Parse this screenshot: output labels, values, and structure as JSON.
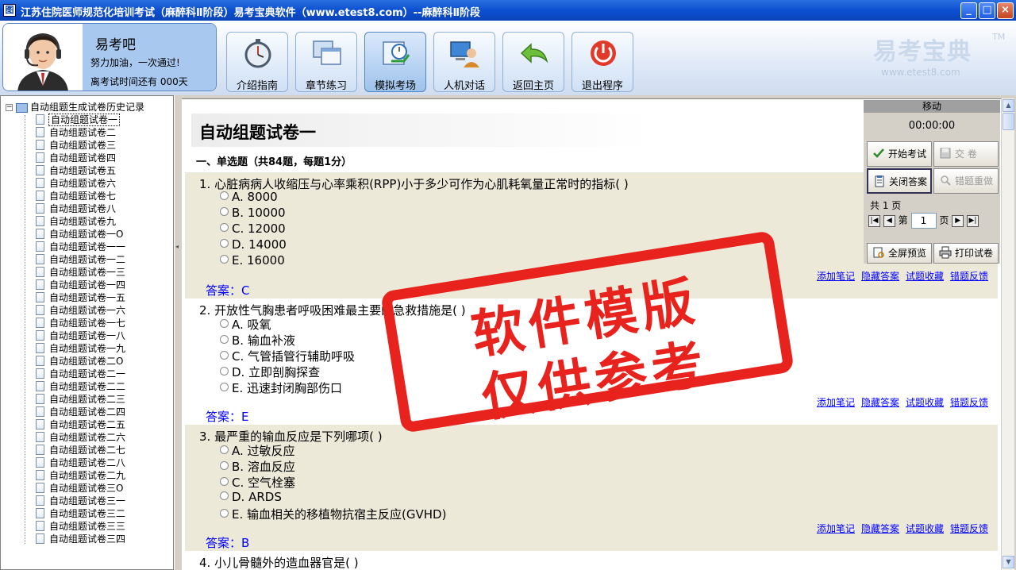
{
  "window": {
    "title": "江苏住院医师规范化培训考试（麻醉科Ⅱ阶段）易考宝典软件（www.etest8.com）--麻醉科Ⅱ阶段",
    "icon_glyph": "图",
    "minimize": "_",
    "maximize": "□",
    "close": "×"
  },
  "profile": {
    "username": "易考吧",
    "motto": "努力加油，一次通过!",
    "days_left": "离考试时间还有 000天"
  },
  "nav": {
    "intro": "介绍指南",
    "chapter": "章节练习",
    "mock": "模拟考场",
    "chat": "人机对话",
    "home": "返回主页",
    "exit": "退出程序"
  },
  "brand": {
    "name": "易考宝典",
    "tm": "TM",
    "url": "www.etest8.com"
  },
  "tree": {
    "root": "自动组题生成试卷历史记录",
    "items": [
      "自动组题试卷一",
      "自动组题试卷二",
      "自动组题试卷三",
      "自动组题试卷四",
      "自动组题试卷五",
      "自动组题试卷六",
      "自动组题试卷七",
      "自动组题试卷八",
      "自动组题试卷九",
      "自动组题试卷一O",
      "自动组题试卷一一",
      "自动组题试卷一二",
      "自动组题试卷一三",
      "自动组题试卷一四",
      "自动组题试卷一五",
      "自动组题试卷一六",
      "自动组题试卷一七",
      "自动组题试卷一八",
      "自动组题试卷一九",
      "自动组题试卷二O",
      "自动组题试卷二一",
      "自动组题试卷二二",
      "自动组题试卷二三",
      "自动组题试卷二四",
      "自动组题试卷二五",
      "自动组题试卷二六",
      "自动组题试卷二七",
      "自动组题试卷二八",
      "自动组题试卷二九",
      "自动组题试卷三O",
      "自动组题试卷三一",
      "自动组题试卷三二",
      "自动组题试卷三三",
      "自动组题试卷三四"
    ]
  },
  "paper": {
    "title": "自动组题试卷一",
    "section": "一、单选题（共84题，每题1分）",
    "answer_prefix": "答案：",
    "links": [
      "添加笔记",
      "隐藏答案",
      "试题收藏",
      "错题反馈"
    ],
    "questions": [
      {
        "stem": "1. 心脏病病人收缩压与心率乘积(RPP)小于多少可作为心肌耗氧量正常时的指标(  )",
        "options": [
          "A. 8000",
          "B. 10000",
          "C. 12000",
          "D. 14000",
          "E. 16000"
        ],
        "answer": "C"
      },
      {
        "stem": "2. 开放性气胸患者呼吸困难最主要的急救措施是(  )",
        "options": [
          "A. 吸氧",
          "B. 输血补液",
          "C. 气管插管行辅助呼吸",
          "D. 立即剖胸探查",
          "E. 迅速封闭胸部伤口"
        ],
        "answer": "E"
      },
      {
        "stem": "3. 最严重的输血反应是下列哪项(  )",
        "options": [
          "A. 过敏反应",
          "B. 溶血反应",
          "C. 空气栓塞",
          "D. ARDS",
          "E. 输血相关的移植物抗宿主反应(GVHD)"
        ],
        "answer": "B"
      },
      {
        "stem": "4. 小儿骨髓外的造血器官是(  )"
      }
    ]
  },
  "panel": {
    "header": "移动",
    "timer": "00:00:00",
    "start": "开始考试",
    "submit": "交    卷",
    "close_answer": "关闭答案",
    "redo_wrong": "错题重做",
    "total_pages": "共 1 页",
    "page_label_before": "第",
    "page_value": "1",
    "page_label_after": "页",
    "fullscreen": "全屏预览",
    "print": "打印试卷"
  },
  "watermark": {
    "line1": "软件模版",
    "line2": "仅供参考"
  }
}
